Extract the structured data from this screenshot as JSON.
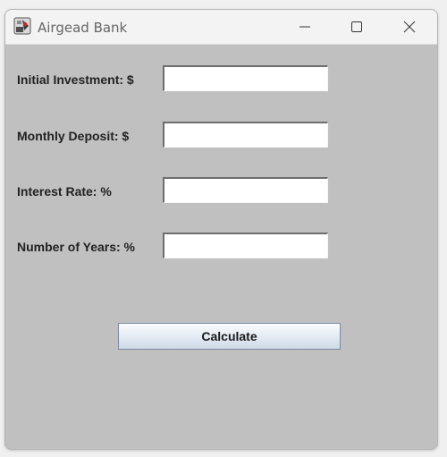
{
  "window": {
    "title": "Airgead Bank",
    "app_icon": "java-app-icon",
    "controls": {
      "minimize": "minimize-icon",
      "maximize": "maximize-icon",
      "close": "close-icon"
    }
  },
  "form": {
    "fields": [
      {
        "label": "Initial Investment: $",
        "value": ""
      },
      {
        "label": "Monthly Deposit: $",
        "value": ""
      },
      {
        "label": "Interest Rate: %",
        "value": ""
      },
      {
        "label": "Number of Years: %",
        "value": ""
      }
    ],
    "calculate_label": "Calculate"
  },
  "colors": {
    "panel_background": "#c0c0c0",
    "titlebar_background": "#f3f3f3",
    "button_gradient_top": "#fbfcfe",
    "button_gradient_bottom": "#cfd9e7",
    "button_border": "#7a8aa3"
  }
}
